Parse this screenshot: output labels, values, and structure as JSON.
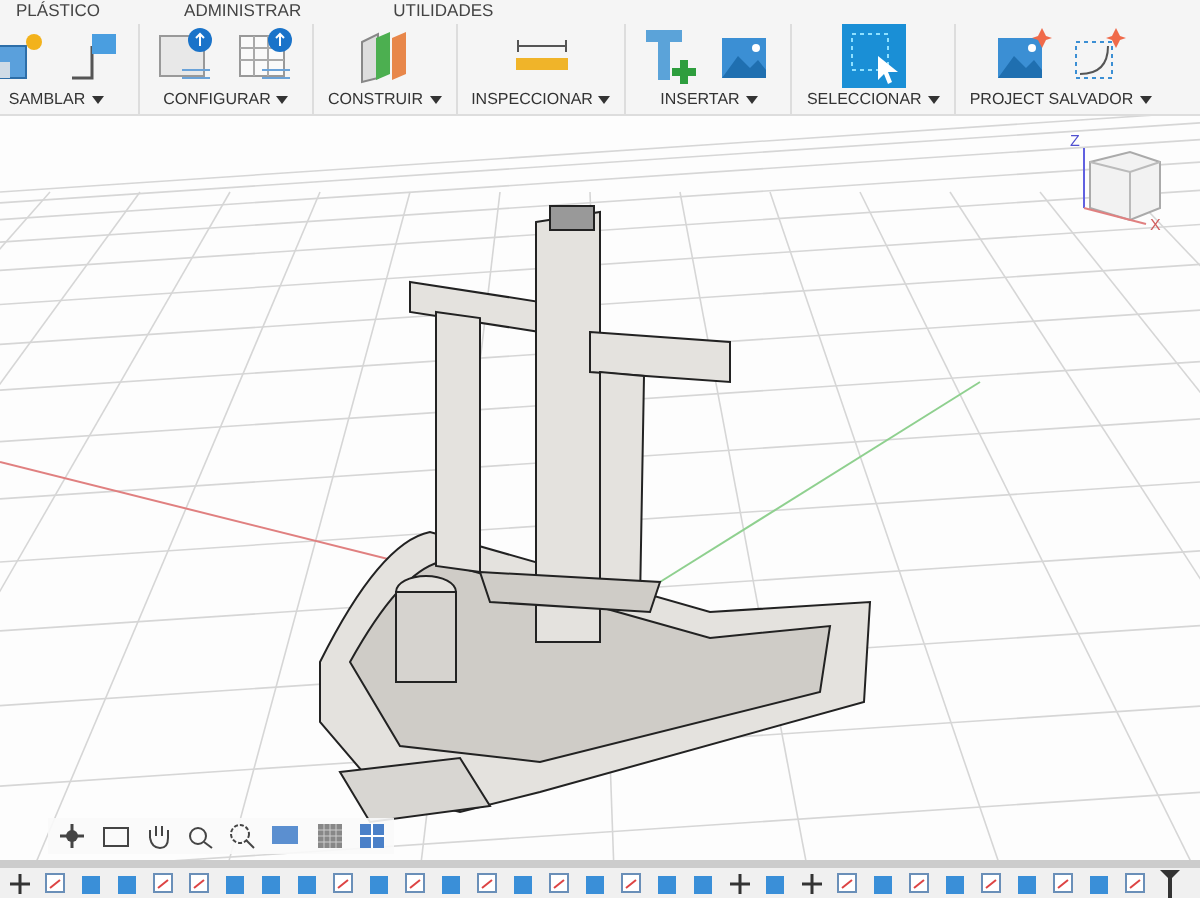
{
  "top_tabs": [
    "PLÁSTICO",
    "ADMINISTRAR",
    "UTILIDADES"
  ],
  "toolbar": [
    {
      "label": "SAMBLAR"
    },
    {
      "label": "CONFIGURAR"
    },
    {
      "label": "CONSTRUIR"
    },
    {
      "label": "INSPECCIONAR"
    },
    {
      "label": "INSERTAR"
    },
    {
      "label": "SELECCIONAR"
    },
    {
      "label": "PROJECT SALVADOR"
    }
  ],
  "view_cube": {
    "axis_z": "Z",
    "axis_x": "X"
  }
}
